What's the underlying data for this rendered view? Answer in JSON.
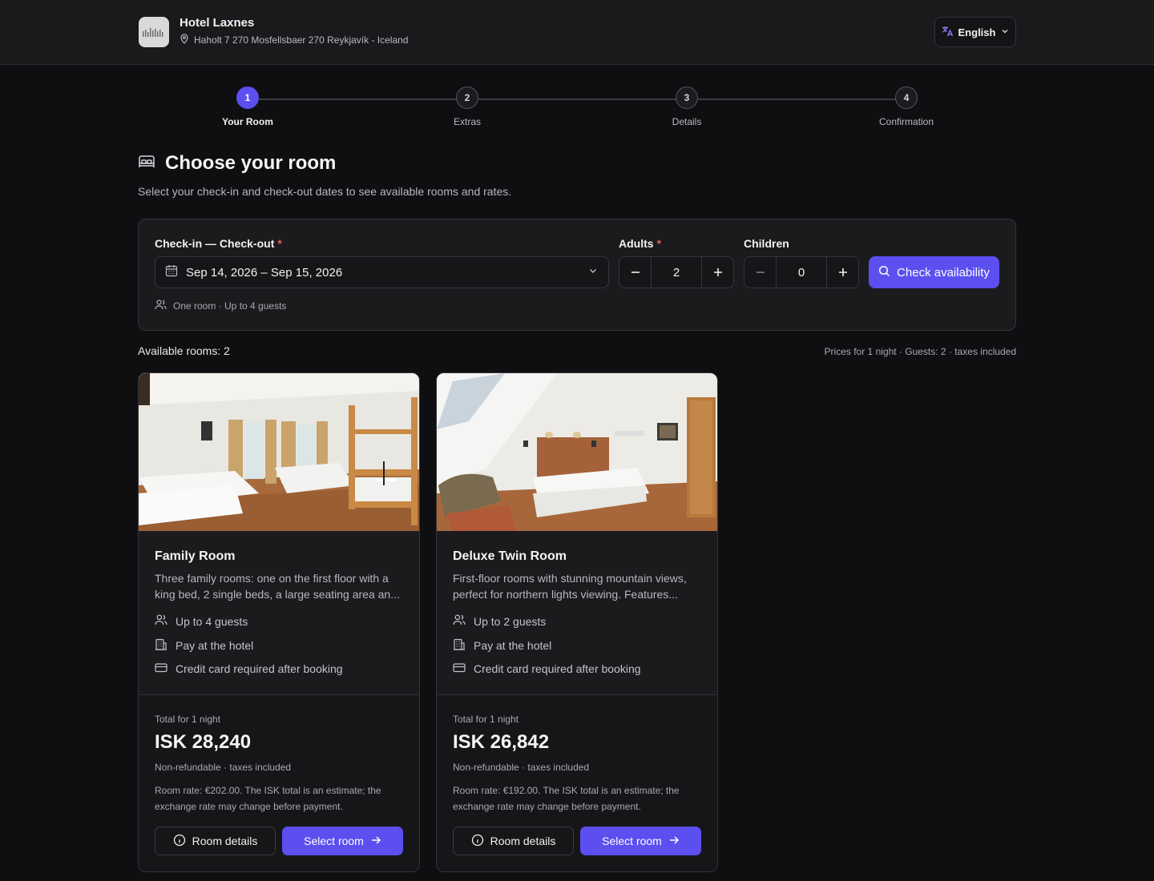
{
  "header": {
    "hotel_name": "Hotel Laxnes",
    "address": "Haholt 7 270 Mosfellsbaer 270 Reykjavík - Iceland",
    "language": "English"
  },
  "steps": [
    {
      "number": "1",
      "label": "Your Room",
      "active": true
    },
    {
      "number": "2",
      "label": "Extras",
      "active": false
    },
    {
      "number": "3",
      "label": "Details",
      "active": false
    },
    {
      "number": "4",
      "label": "Confirmation",
      "active": false
    }
  ],
  "page": {
    "title": "Choose your room",
    "subtitle": "Select your check-in and check-out dates to see available rooms and rates."
  },
  "search": {
    "dates_label": "Check-in — Check-out",
    "dates_value": "Sep 14, 2026 – Sep 15, 2026",
    "adults_label": "Adults",
    "adults_value": "2",
    "children_label": "Children",
    "children_value": "0",
    "required_mark": "*",
    "check_button": "Check availability",
    "hint": "One room · Up to 4 guests"
  },
  "results": {
    "available": "Available rooms: 2",
    "prices_note": "Prices for 1 night · Guests: 2 · taxes included"
  },
  "rooms": [
    {
      "name": "Family Room",
      "description": "Three family rooms: one on the first floor with a king bed, 2 single beds, a large seating area an...",
      "features": [
        "Up to 4 guests",
        "Pay at the hotel",
        "Credit card required after booking"
      ],
      "total_label": "Total for 1 night",
      "price": "ISK 28,240",
      "price_note": "Non-refundable · taxes included",
      "rate_note": "Room rate: €202.00. The ISK total is an estimate; the exchange rate may change before payment.",
      "details_button": "Room details",
      "select_button": "Select room"
    },
    {
      "name": "Deluxe Twin Room",
      "description": "First-floor rooms with stunning mountain views, perfect for northern lights viewing. Features...",
      "features": [
        "Up to 2 guests",
        "Pay at the hotel",
        "Credit card required after booking"
      ],
      "total_label": "Total for 1 night",
      "price": "ISK 26,842",
      "price_note": "Non-refundable · taxes included",
      "rate_note": "Room rate: €192.00. The ISK total is an estimate; the exchange rate may change before payment.",
      "details_button": "Room details",
      "select_button": "Select room"
    }
  ],
  "colors": {
    "accent": "#5b4ff0",
    "background": "#0f0f11",
    "surface": "#1b1b1e",
    "required": "#ef5b5b"
  }
}
